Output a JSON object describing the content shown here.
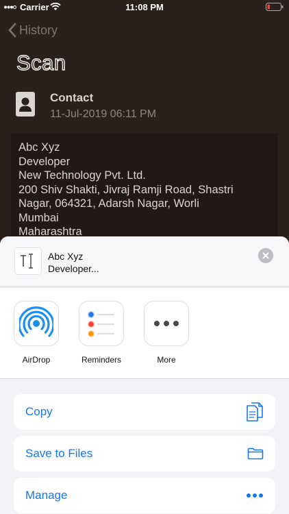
{
  "status_bar": {
    "carrier": "Carrier",
    "time": "11:08 PM"
  },
  "nav": {
    "back_label": "History"
  },
  "page": {
    "title": "Scan"
  },
  "contact": {
    "type": "Contact",
    "date": "11-Jul-2019 06:11 PM"
  },
  "scan_lines": [
    "Abc Xyz",
    "Developer",
    "New Technology Pvt. Ltd.",
    "200 Shiv Shakti, Jivraj Ramji Road, Shastri",
    "Nagar, 064321, Adarsh Nagar, Worli",
    "Mumbai",
    "Maharashtra"
  ],
  "share_sheet": {
    "preview_lines": [
      "Abc Xyz",
      "Developer..."
    ],
    "apps": [
      {
        "label": "AirDrop",
        "icon": "airdrop-icon"
      },
      {
        "label": "Reminders",
        "icon": "reminders-icon"
      },
      {
        "label": "More",
        "icon": "more-icon"
      }
    ],
    "actions": [
      {
        "label": "Copy",
        "icon": "copy-icon"
      },
      {
        "label": "Save to Files",
        "icon": "folder-icon"
      },
      {
        "label": "Manage",
        "icon": "ellipsis-icon"
      }
    ]
  },
  "colors": {
    "accent": "#1677f0",
    "background": "#2a201c",
    "sheet": "#f3f2f6"
  }
}
